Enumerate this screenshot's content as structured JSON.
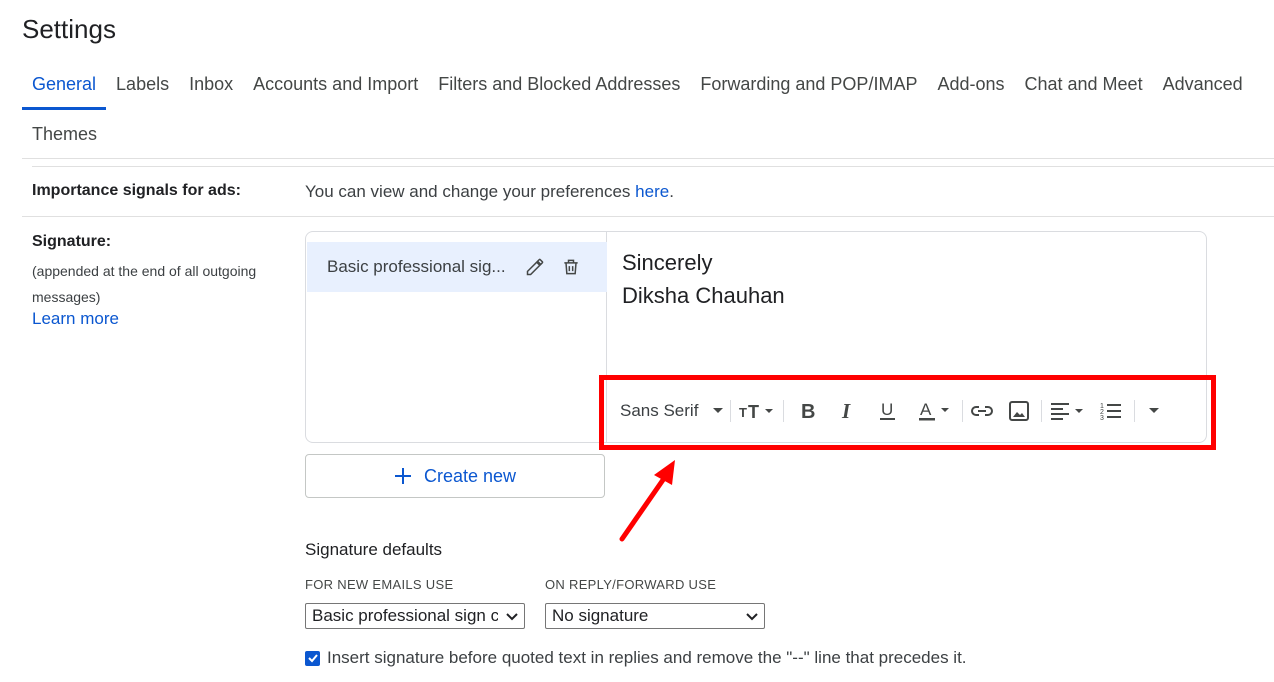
{
  "page": {
    "title": "Settings"
  },
  "tabs": [
    {
      "label": "General",
      "active": true
    },
    {
      "label": "Labels"
    },
    {
      "label": "Inbox"
    },
    {
      "label": "Accounts and Import"
    },
    {
      "label": "Filters and Blocked Addresses"
    },
    {
      "label": "Forwarding and POP/IMAP"
    },
    {
      "label": "Add-ons"
    },
    {
      "label": "Chat and Meet"
    },
    {
      "label": "Advanced"
    },
    {
      "label": "Themes"
    }
  ],
  "ads": {
    "label": "Importance signals for ads:",
    "text": "You can view and change your preferences ",
    "link": "here",
    "suffix": "."
  },
  "signature": {
    "label": "Signature:",
    "sublabel": "(appended at the end of all outgoing messages)",
    "learn_more": "Learn more",
    "item_name": "Basic professional sig...",
    "editor_line1": "Sincerely",
    "editor_line2": "Diksha Chauhan",
    "create_new": "Create new",
    "toolbar": {
      "font": "Sans Serif",
      "icons": [
        "text-size-icon",
        "bold-icon",
        "italic-icon",
        "underline-icon",
        "text-color-icon",
        "link-icon",
        "image-icon",
        "align-icon",
        "numbered-list-icon",
        "more-icon"
      ]
    }
  },
  "defaults": {
    "title": "Signature defaults",
    "new_label": "FOR NEW EMAILS USE",
    "new_value": "Basic professional sign c",
    "reply_label": "ON REPLY/FORWARD USE",
    "reply_value": "No signature",
    "checkbox_checked": true,
    "checkbox_label": "Insert signature before quoted text in replies and remove the \"--\" line that precedes it."
  },
  "colors": {
    "accent": "#0b57d0",
    "highlight": "#ff0000",
    "selected_bg": "#e8f0fe"
  }
}
